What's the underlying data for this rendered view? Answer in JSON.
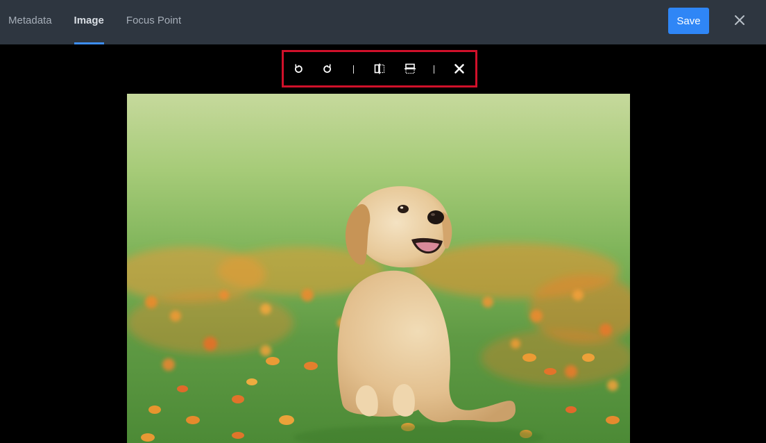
{
  "tabs": [
    {
      "label": "Metadata",
      "active": false
    },
    {
      "label": "Image",
      "active": true
    },
    {
      "label": "Focus Point",
      "active": false
    }
  ],
  "header": {
    "save_label": "Save",
    "close_icon": "close-icon"
  },
  "toolbar": {
    "tools": [
      {
        "name": "rotate-left",
        "icon": "rotate-left-icon"
      },
      {
        "name": "rotate-right",
        "icon": "rotate-right-icon"
      },
      {
        "name": "flip-horizontal",
        "icon": "flip-horizontal-icon"
      },
      {
        "name": "flip-vertical",
        "icon": "flip-vertical-icon"
      },
      {
        "name": "cancel",
        "icon": "close-icon"
      }
    ],
    "highlight_color": "#d0102a"
  },
  "image": {
    "subject": "puppy-photo"
  },
  "colors": {
    "topbar": "#2e3640",
    "accent": "#2f86f6",
    "tab_active": "#d9dee4",
    "tab_inactive": "#a6aeb8",
    "canvas": "#000000"
  }
}
